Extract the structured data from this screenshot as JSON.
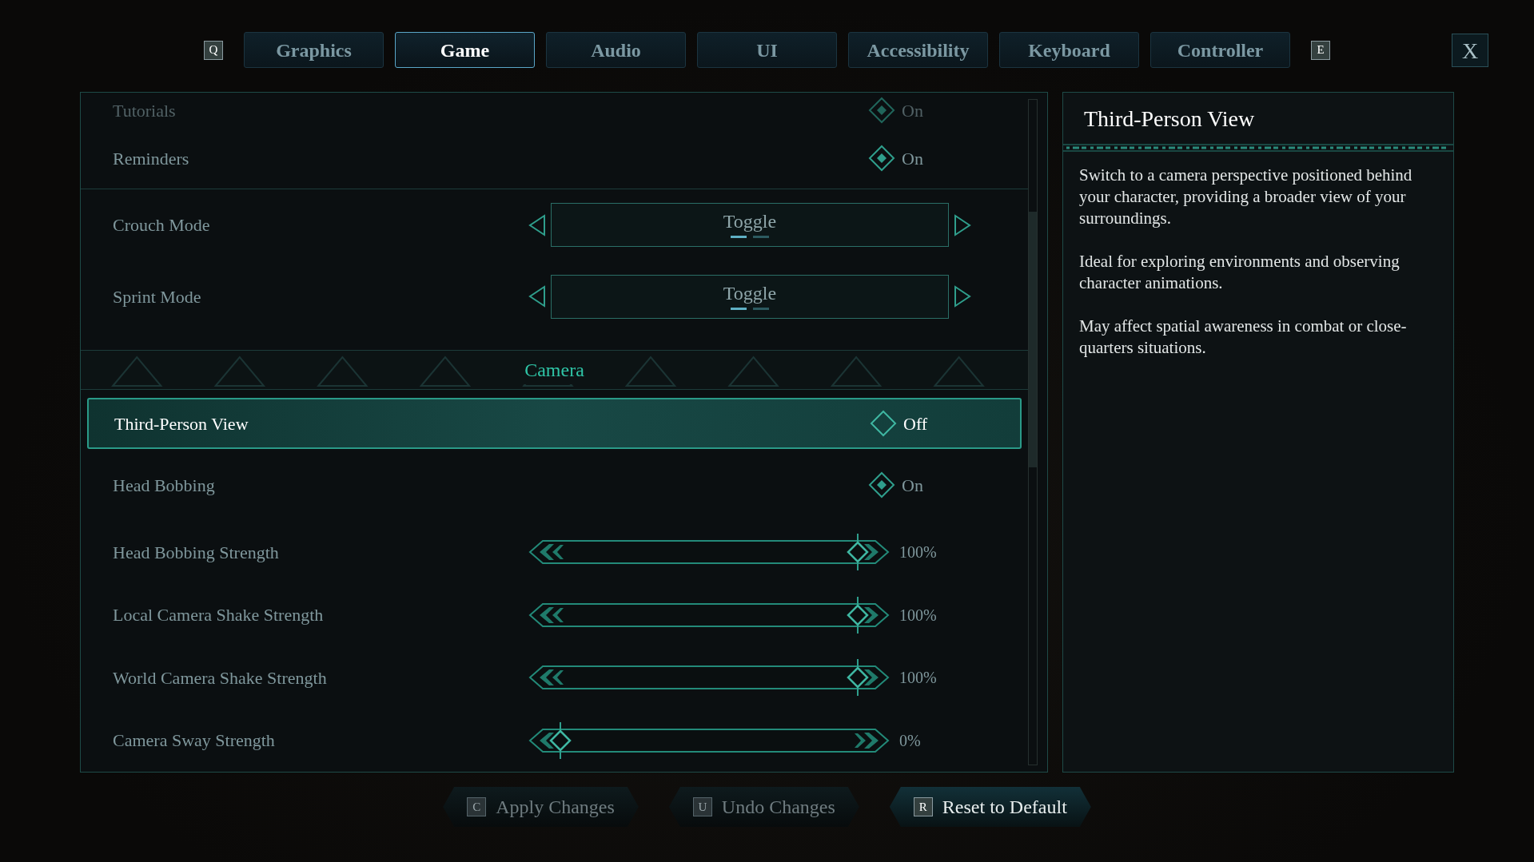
{
  "tabs_bar": {
    "prev_key": "Q",
    "next_key": "E",
    "tabs": [
      {
        "label": "Graphics",
        "selected": false
      },
      {
        "label": "Game",
        "selected": true
      },
      {
        "label": "Audio",
        "selected": false
      },
      {
        "label": "UI",
        "selected": false
      },
      {
        "label": "Accessibility",
        "selected": false
      },
      {
        "label": "Keyboard",
        "selected": false
      },
      {
        "label": "Controller",
        "selected": false
      }
    ]
  },
  "close_button": "X",
  "settings": [
    {
      "kind": "toggle",
      "label": "Tutorials",
      "value": "On",
      "on": true,
      "selected": false,
      "faded": true
    },
    {
      "kind": "toggle",
      "label": "Reminders",
      "value": "On",
      "on": true,
      "selected": false,
      "group_end": true
    },
    {
      "kind": "selector",
      "label": "Crouch Mode",
      "value": "Toggle",
      "pages": [
        {
          "selected": true
        },
        {
          "selected": false
        }
      ],
      "selected": false
    },
    {
      "kind": "selector",
      "label": "Sprint Mode",
      "value": "Toggle",
      "pages": [
        {
          "selected": true
        },
        {
          "selected": false
        }
      ],
      "selected": false
    },
    {
      "kind": "header",
      "label": "Camera"
    },
    {
      "kind": "toggle",
      "label": "Third-Person View",
      "value": "Off",
      "on": false,
      "selected": true
    },
    {
      "kind": "toggle",
      "label": "Head Bobbing",
      "value": "On",
      "on": true,
      "selected": false
    },
    {
      "kind": "slider",
      "label": "Head Bobbing Strength",
      "level": 1,
      "reading": "100%",
      "selected": false
    },
    {
      "kind": "slider",
      "label": "Local Camera Shake Strength",
      "level": 1,
      "reading": "100%",
      "selected": false
    },
    {
      "kind": "slider",
      "label": "World Camera Shake Strength",
      "level": 1,
      "reading": "100%",
      "selected": false
    },
    {
      "kind": "slider",
      "label": "Camera Sway Strength",
      "level": 0,
      "reading": "0%",
      "selected": false
    }
  ],
  "detail": {
    "title": "Third-Person View",
    "paragraphs": [
      "Switch to a camera perspective positioned behind your character, providing a broader view of your surroundings.",
      "Ideal for exploring environments and observing character animations.",
      "May affect spatial awareness in combat or close-quarters situations."
    ]
  },
  "actions": [
    {
      "key": "C",
      "label": "Apply Changes",
      "disabled": true
    },
    {
      "key": "U",
      "label": "Undo Changes",
      "disabled": true
    },
    {
      "key": "R",
      "label": "Reset to Default",
      "disabled": false
    }
  ]
}
